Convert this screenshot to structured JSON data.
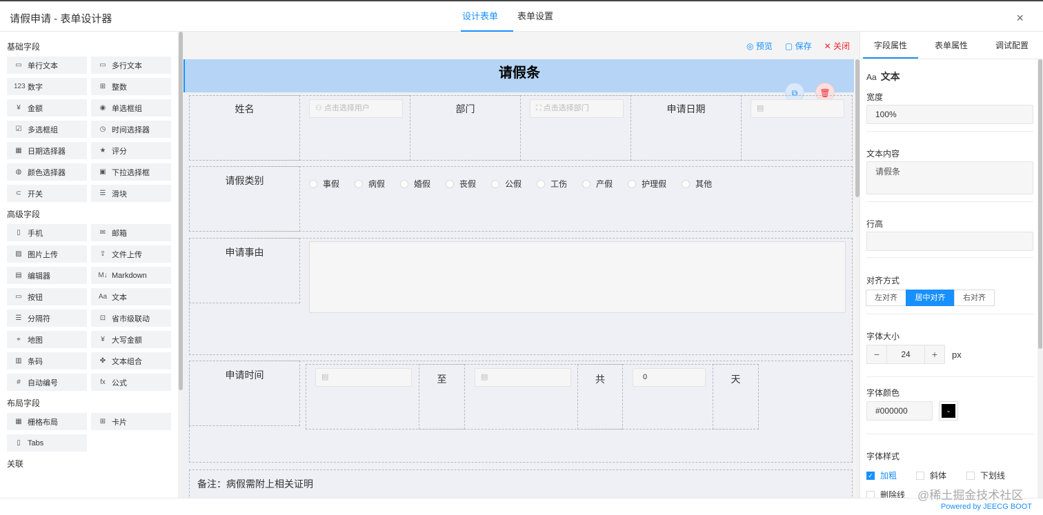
{
  "window": {
    "title": "请假申请 - 表单设计器",
    "close_icon": "×"
  },
  "top_tabs": [
    {
      "label": "设计表单",
      "active": true
    },
    {
      "label": "表单设置",
      "active": false
    }
  ],
  "left": {
    "groups": [
      {
        "title": "基础字段",
        "items": [
          {
            "icon": "▭",
            "label": "单行文本"
          },
          {
            "icon": "▭",
            "label": "多行文本"
          },
          {
            "icon": "123",
            "label": "数字"
          },
          {
            "icon": "⊞",
            "label": "整数"
          },
          {
            "icon": "¥",
            "label": "金额"
          },
          {
            "icon": "◉",
            "label": "单选框组"
          },
          {
            "icon": "☑",
            "label": "多选框组"
          },
          {
            "icon": "◷",
            "label": "时间选择器"
          },
          {
            "icon": "▦",
            "label": "日期选择器"
          },
          {
            "icon": "★",
            "label": "评分"
          },
          {
            "icon": "◍",
            "label": "颜色选择器"
          },
          {
            "icon": "▣",
            "label": "下拉选择框"
          },
          {
            "icon": "⊂",
            "label": "开关"
          },
          {
            "icon": "☰",
            "label": "滑块"
          }
        ]
      },
      {
        "title": "高级字段",
        "items": [
          {
            "icon": "▯",
            "label": "手机"
          },
          {
            "icon": "✉",
            "label": "邮箱"
          },
          {
            "icon": "▨",
            "label": "图片上传"
          },
          {
            "icon": "⇪",
            "label": "文件上传"
          },
          {
            "icon": "▤",
            "label": "编辑器"
          },
          {
            "icon": "M↓",
            "label": "Markdown"
          },
          {
            "icon": "▭",
            "label": "按钮"
          },
          {
            "icon": "Aa",
            "label": "文本"
          },
          {
            "icon": "☰",
            "label": "分隔符"
          },
          {
            "icon": "⊡",
            "label": "省市级联动"
          },
          {
            "icon": "⌖",
            "label": "地图"
          },
          {
            "icon": "¥",
            "label": "大写金额"
          },
          {
            "icon": "▥",
            "label": "条码"
          },
          {
            "icon": "✤",
            "label": "文本组合"
          },
          {
            "icon": "#",
            "label": "自动编号"
          },
          {
            "icon": "fx",
            "label": "公式"
          }
        ]
      },
      {
        "title": "布局字段",
        "items": [
          {
            "icon": "▦",
            "label": "栅格布局"
          },
          {
            "icon": "⊞",
            "label": "卡片"
          },
          {
            "icon": "▯",
            "label": "Tabs"
          }
        ]
      },
      {
        "title": "关联",
        "items": []
      }
    ]
  },
  "toolbar": {
    "preview": "◎ 预览",
    "save": "▢ 保存",
    "close": "✕ 关闭"
  },
  "form": {
    "header_text": "请假条",
    "copy_icon": "⧉",
    "delete_icon": "🗑",
    "rows": {
      "name_label": "姓名",
      "user_placeholder": "点击选择用户",
      "dept_label": "部门",
      "dept_placeholder": "点击选择部门",
      "date_label": "申请日期",
      "type_label": "请假类别",
      "reason_label": "申请事由",
      "time_label": "申请时间",
      "to": "至",
      "total": "共",
      "days_value": "0",
      "day": "天",
      "note": "备注：病假需附上相关证明"
    },
    "leave_types": [
      "事假",
      "病假",
      "婚假",
      "丧假",
      "公假",
      "工伤",
      "产假",
      "护理假",
      "其他"
    ]
  },
  "right": {
    "tabs": [
      {
        "label": "字段属性",
        "active": true
      },
      {
        "label": "表单属性",
        "active": false
      },
      {
        "label": "调试配置",
        "active": false
      }
    ],
    "field_type": "文本",
    "field_type_icon": "Aa",
    "width_label": "宽度",
    "width_value": "100%",
    "content_label": "文本内容",
    "content_value": "请假条",
    "line_height_label": "行高",
    "align_label": "对齐方式",
    "align_options": [
      "左对齐",
      "居中对齐",
      "右对齐"
    ],
    "align_active": 1,
    "font_size_label": "字体大小",
    "font_size": "24",
    "font_unit": "px",
    "font_color_label": "字体颜色",
    "font_color": "#000000",
    "font_style_label": "字体样式",
    "styles": [
      {
        "label": "加粗",
        "checked": true
      },
      {
        "label": "斜体",
        "checked": false
      },
      {
        "label": "下划线",
        "checked": false
      },
      {
        "label": "删除线",
        "checked": false
      }
    ]
  },
  "footer": {
    "powered": "Powered by JEECG BOOT",
    "watermark": "@稀土掘金技术社区"
  }
}
